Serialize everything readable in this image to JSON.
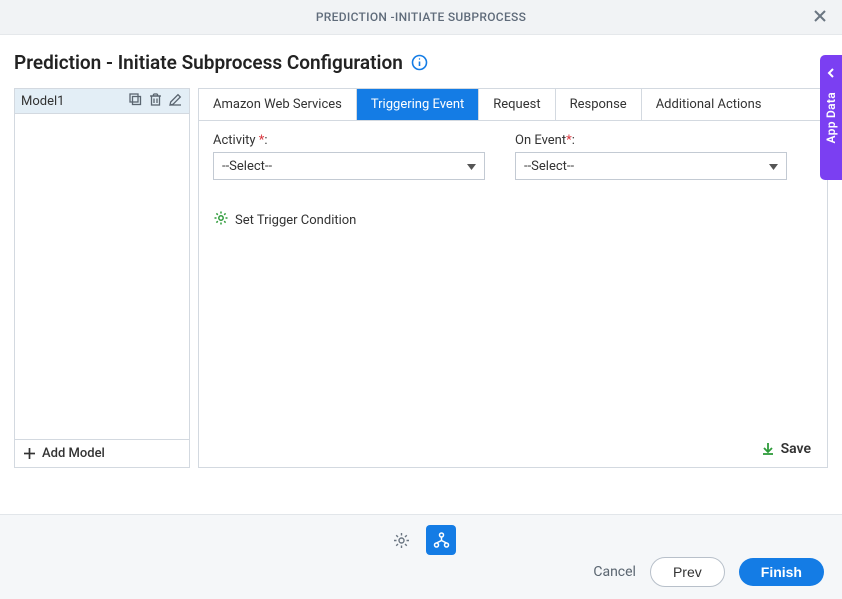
{
  "header": {
    "title": "PREDICTION -INITIATE SUBPROCESS"
  },
  "page_title": "Prediction - Initiate Subprocess Configuration",
  "sidebar": {
    "model_name": "Model1",
    "add_label": "Add Model"
  },
  "tabs": [
    {
      "label": "Amazon Web Services"
    },
    {
      "label": "Triggering Event"
    },
    {
      "label": "Request"
    },
    {
      "label": "Response"
    },
    {
      "label": "Additional Actions"
    }
  ],
  "form": {
    "activity_label": "Activity ",
    "activity_value": "--Select--",
    "onevent_label": "On Event",
    "onevent_value": "--Select--"
  },
  "trigger_link": "Set Trigger Condition",
  "save_label": "Save",
  "app_data_label": "App Data",
  "footer": {
    "cancel": "Cancel",
    "prev": "Prev",
    "finish": "Finish"
  }
}
